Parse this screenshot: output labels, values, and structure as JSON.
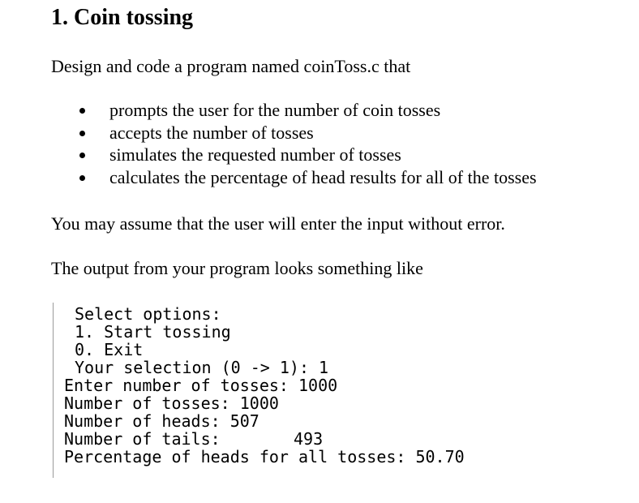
{
  "heading": "1. Coin tossing",
  "intro": "Design and code a program named coinToss.c that",
  "bullets": [
    "prompts the user for the number of coin tosses",
    "accepts the number of tosses",
    "simulates the requested number of tosses",
    "calculates the percentage of head results for all of the tosses"
  ],
  "assumption": "You may assume that the user will enter the input without error.",
  "output_intro": "The output from your program looks something like",
  "console": {
    "lines": [
      "Select options:",
      "1. Start tossing",
      "0. Exit",
      "Your selection (0 -> 1): 1",
      "Enter number of tosses: 1000",
      "Number of tosses: 1000",
      "Number of heads: 507",
      "Number of tails:",
      "493",
      "Percentage of heads for all tosses: 50.70"
    ]
  }
}
